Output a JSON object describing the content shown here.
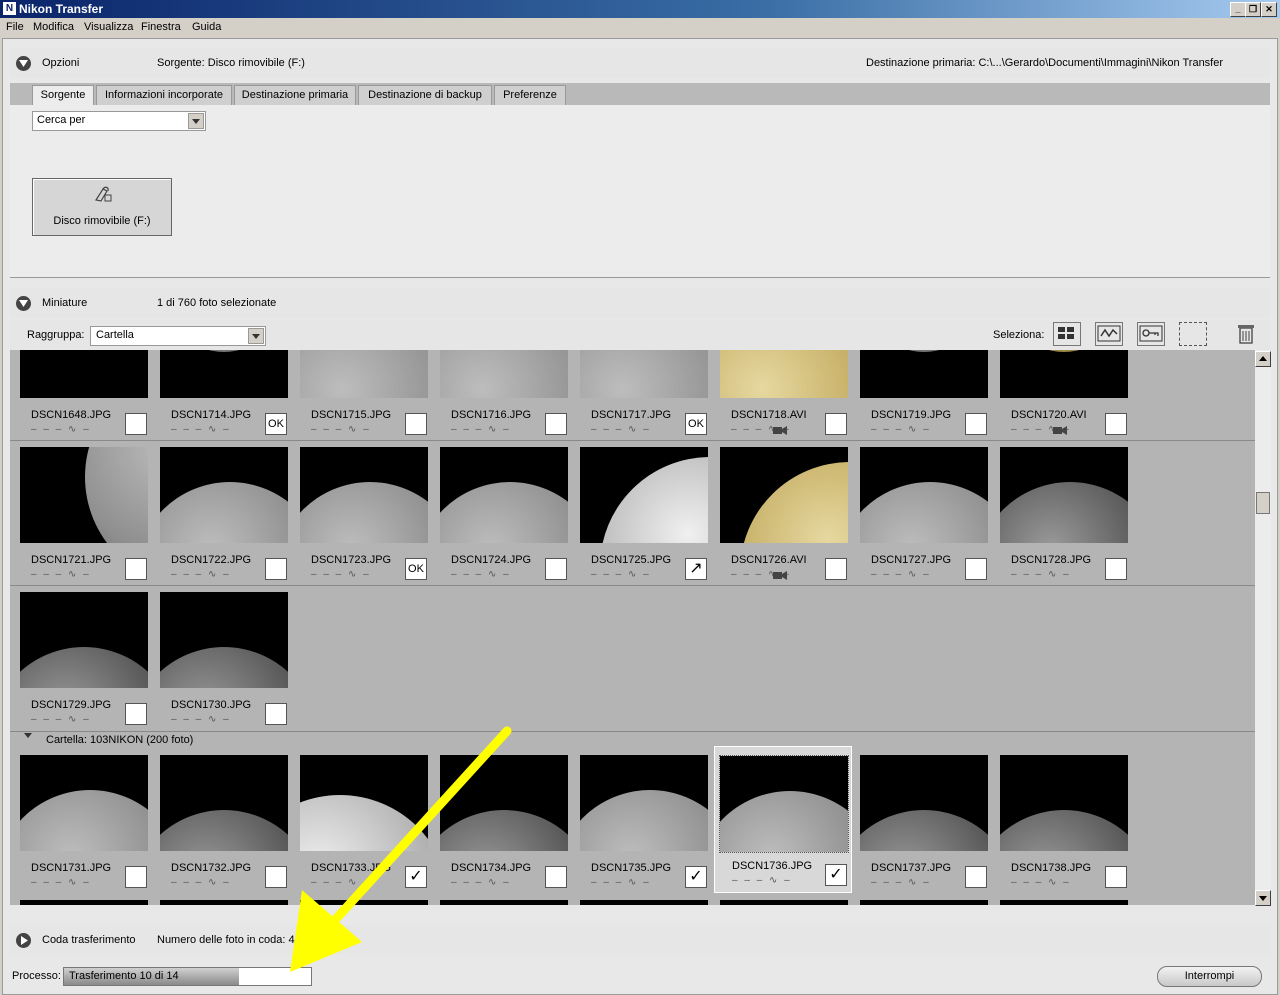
{
  "window": {
    "title": "Nikon Transfer"
  },
  "menu": [
    "File",
    "Modifica",
    "Visualizza",
    "Finestra",
    "Guida"
  ],
  "options": {
    "label": "Opzioni",
    "source": "Sorgente: Disco rimovibile (F:)",
    "destination": "Destinazione primaria:  C:\\...\\Gerardo\\Documenti\\Immagini\\Nikon Transfer"
  },
  "tabs": [
    "Sorgente",
    "Informazioni incorporate",
    "Destinazione primaria",
    "Destinazione di backup",
    "Preferenze"
  ],
  "search": {
    "value": "Cerca per"
  },
  "device": {
    "label": "Disco rimovibile (F:)"
  },
  "thumbnails": {
    "label": "Miniature",
    "selection": "1 di 760 foto selezionate",
    "group_label": "Raggruppa:",
    "group_value": "Cartella",
    "select_label": "Seleziona:",
    "folder_header": "Cartella: 103NIKON (200 foto)"
  },
  "meta_text": "– – – ∿ –",
  "rows": [
    [
      {
        "name": "DSCN1648.JPG",
        "mark": "",
        "img": "black"
      },
      {
        "name": "DSCN1714.JPG",
        "mark": "OK",
        "img": "fullmoon"
      },
      {
        "name": "DSCN1715.JPG",
        "mark": "",
        "img": "moontop"
      },
      {
        "name": "DSCN1716.JPG",
        "mark": "",
        "img": "moontop"
      },
      {
        "name": "DSCN1717.JPG",
        "mark": "OK",
        "img": "moontop"
      },
      {
        "name": "DSCN1718.AVI",
        "mark": "",
        "img": "yellowtop",
        "video": true
      },
      {
        "name": "DSCN1719.JPG",
        "mark": "",
        "img": "fullmoon"
      },
      {
        "name": "DSCN1720.AVI",
        "mark": "",
        "img": "yellowfull",
        "video": true
      }
    ],
    [
      {
        "name": "DSCN1721.JPG",
        "mark": "",
        "img": "moonside"
      },
      {
        "name": "DSCN1722.JPG",
        "mark": "",
        "img": "moon"
      },
      {
        "name": "DSCN1723.JPG",
        "mark": "OK",
        "img": "moon"
      },
      {
        "name": "DSCN1724.JPG",
        "mark": "",
        "img": "moon"
      },
      {
        "name": "DSCN1725.JPG",
        "mark": "↗",
        "img": "moondiag"
      },
      {
        "name": "DSCN1726.AVI",
        "mark": "",
        "img": "yellowdiag",
        "video": true
      },
      {
        "name": "DSCN1727.JPG",
        "mark": "",
        "img": "moon"
      },
      {
        "name": "DSCN1728.JPG",
        "mark": "",
        "img": "moondark"
      }
    ],
    [
      {
        "name": "DSCN1729.JPG",
        "mark": "",
        "img": "moonlow"
      },
      {
        "name": "DSCN1730.JPG",
        "mark": "",
        "img": "moonlow"
      }
    ],
    [
      {
        "name": "DSCN1731.JPG",
        "mark": "",
        "img": "moon"
      },
      {
        "name": "DSCN1732.JPG",
        "mark": "",
        "img": "moonlow"
      },
      {
        "name": "DSCN1733.JPG",
        "mark": "✓",
        "img": "moonbright"
      },
      {
        "name": "DSCN1734.JPG",
        "mark": "",
        "img": "moonlow"
      },
      {
        "name": "DSCN1735.JPG",
        "mark": "✓",
        "img": "moon"
      },
      {
        "name": "DSCN1736.JPG",
        "mark": "✓",
        "img": "moon",
        "selected": true
      },
      {
        "name": "DSCN1737.JPG",
        "mark": "",
        "img": "moonlow"
      },
      {
        "name": "DSCN1738.JPG",
        "mark": "",
        "img": "moonlow"
      }
    ]
  ],
  "queue": {
    "label": "Coda trasferimento",
    "count": "Numero delle foto in coda: 4"
  },
  "process": {
    "label": "Processo:",
    "progress_text": "Trasferimento 10 di 14",
    "progress_fraction": 0.71
  },
  "buttons": {
    "interrupt": "Interrompi"
  },
  "colors": {
    "annotation_arrow": "#ffff00"
  }
}
